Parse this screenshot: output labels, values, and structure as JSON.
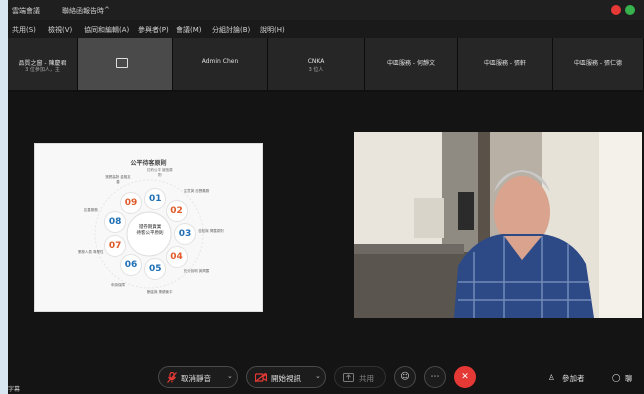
{
  "window": {
    "title_left": "雲端會議",
    "title_center": "聯絡函報告時",
    "title_chevron": "^"
  },
  "menu": [
    "共用(S)",
    "檢視(V)",
    "協同和編輯(A)",
    "參與者(P)",
    "會議(M)",
    "分組討論(B)",
    "說明(H)"
  ],
  "participants": [
    {
      "name": "品質之窗 - 陳慶君",
      "sub": "3 位參加人，主"
    },
    {
      "name": "",
      "sub": "",
      "active": true
    },
    {
      "name": "Admin Chen",
      "sub": ""
    },
    {
      "name": "CNKA",
      "sub": "3 位人"
    },
    {
      "name": "中區服務 - 何靜文",
      "sub": ""
    },
    {
      "name": "中區服務 - 張軒",
      "sub": ""
    },
    {
      "name": "中區服務 - 張仁德",
      "sub": ""
    }
  ],
  "shared_slide": {
    "title": "公平待客原則",
    "center_text": "證券期貨業\n待客公平原則",
    "nodes": [
      "01",
      "02",
      "03",
      "04",
      "05",
      "06",
      "07",
      "08",
      "09"
    ],
    "node_colors": [
      "#1f6fb5",
      "#e05a2a",
      "#1f6fb5",
      "#e05a2a",
      "#1f6fb5",
      "#1f6fb5",
      "#e05a2a",
      "#1f6fb5",
      "#e05a2a"
    ],
    "node_labels": [
      "訂約公平 誠信原則",
      "注意與 忠實義務",
      "告知與 揭露原則",
      "充分說明 與揭露",
      "酬金與 業績衡平",
      "申訴保障",
      "業務人員 專業性",
      "友善服務",
      "落實高齡 金融友善"
    ]
  },
  "controls": {
    "mute": "取消靜音",
    "video": "開始視訊",
    "share": "共用",
    "participants": "參加者",
    "more": "聊"
  },
  "colors": {
    "leave": "#e53935",
    "mute_icon": "#e53935",
    "video_icon": "#e53935"
  },
  "bottom_left": "字幕"
}
